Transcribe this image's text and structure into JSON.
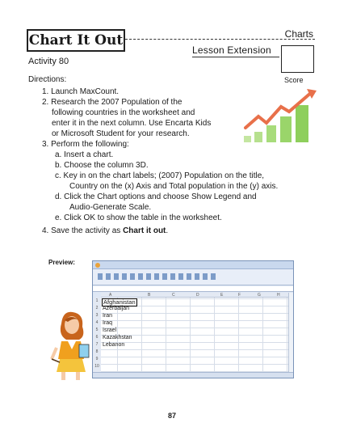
{
  "header": {
    "title": "Chart It Out",
    "subject": "Charts",
    "lesson_extension": "Lesson Extension",
    "score_label": "Score",
    "activity": "Activity 80"
  },
  "directions": {
    "heading": "Directions:",
    "step1": "1. Launch MaxCount.",
    "step2a": "2. Research the 2007 Population of the",
    "step2b": "following countries in the worksheet and",
    "step2c": "enter it in the next column. Use Encarta Kids",
    "step2d": "or Microsoft Student for your research.",
    "step3": "3. Perform the following:",
    "sub_a": "a.  Insert a chart.",
    "sub_b": "b.  Choose the column 3D.",
    "sub_c1": "c.  Key in on the chart labels; (2007) Population on the title,",
    "sub_c2": "Country on the (x) Axis and Total population in the (y) axis.",
    "sub_d1": "d.  Click the Chart options and choose Show Legend and",
    "sub_d2": "Audio-Generate Scale.",
    "sub_e": "e.  Click OK to show the table in the worksheet.",
    "step4_prefix": "4. Save the activity as ",
    "step4_bold": "Chart it out",
    "step4_suffix": "."
  },
  "preview": {
    "label": "Preview:",
    "countries": [
      "Afghanistan",
      "Azerbaijan",
      "Iran",
      "Iraq",
      "Israel",
      "Kazakhstan",
      "Lebanon"
    ],
    "row_numbers": [
      "1",
      "2",
      "3",
      "4",
      "5",
      "6",
      "7",
      "8",
      "9",
      "10"
    ],
    "columns": [
      "A",
      "B",
      "C",
      "D",
      "E",
      "F",
      "G",
      "H"
    ]
  },
  "page_number": "87"
}
